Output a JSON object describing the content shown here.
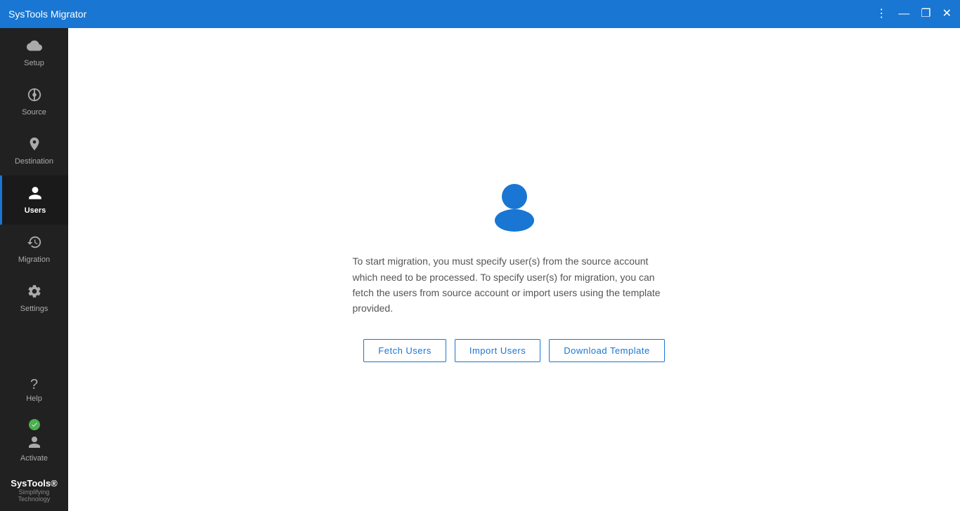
{
  "titleBar": {
    "title": "SysTools Migrator",
    "controls": {
      "menu": "⋮",
      "minimize": "—",
      "maximize": "❐",
      "close": "✕"
    }
  },
  "sidebar": {
    "items": [
      {
        "id": "setup",
        "label": "Setup",
        "icon": "cloud"
      },
      {
        "id": "source",
        "label": "Source",
        "icon": "source"
      },
      {
        "id": "destination",
        "label": "Destination",
        "icon": "destination"
      },
      {
        "id": "users",
        "label": "Users",
        "icon": "person",
        "active": true
      },
      {
        "id": "migration",
        "label": "Migration",
        "icon": "history"
      },
      {
        "id": "settings",
        "label": "Settings",
        "icon": "gear"
      }
    ],
    "bottom": {
      "help": {
        "label": "Help",
        "icon": "?"
      },
      "activate": {
        "label": "Activate",
        "icon": "person"
      }
    },
    "brand": {
      "name": "SysTools®",
      "tagline": "Simplifying Technology"
    }
  },
  "main": {
    "description": "To start migration, you must specify user(s) from the source account which need to be processed. To specify user(s) for migration, you can fetch the users from source account or import users using the template provided.",
    "buttons": {
      "fetchUsers": "Fetch Users",
      "importUsers": "Import Users",
      "downloadTemplate": "Download Template"
    }
  },
  "colors": {
    "titleBarBg": "#1976D2",
    "sidebarBg": "#212121",
    "activeBlue": "#1976D2",
    "activeBorder": "#1976D2",
    "userIconColor": "#1976D2",
    "activateDot": "#4CAF50"
  }
}
